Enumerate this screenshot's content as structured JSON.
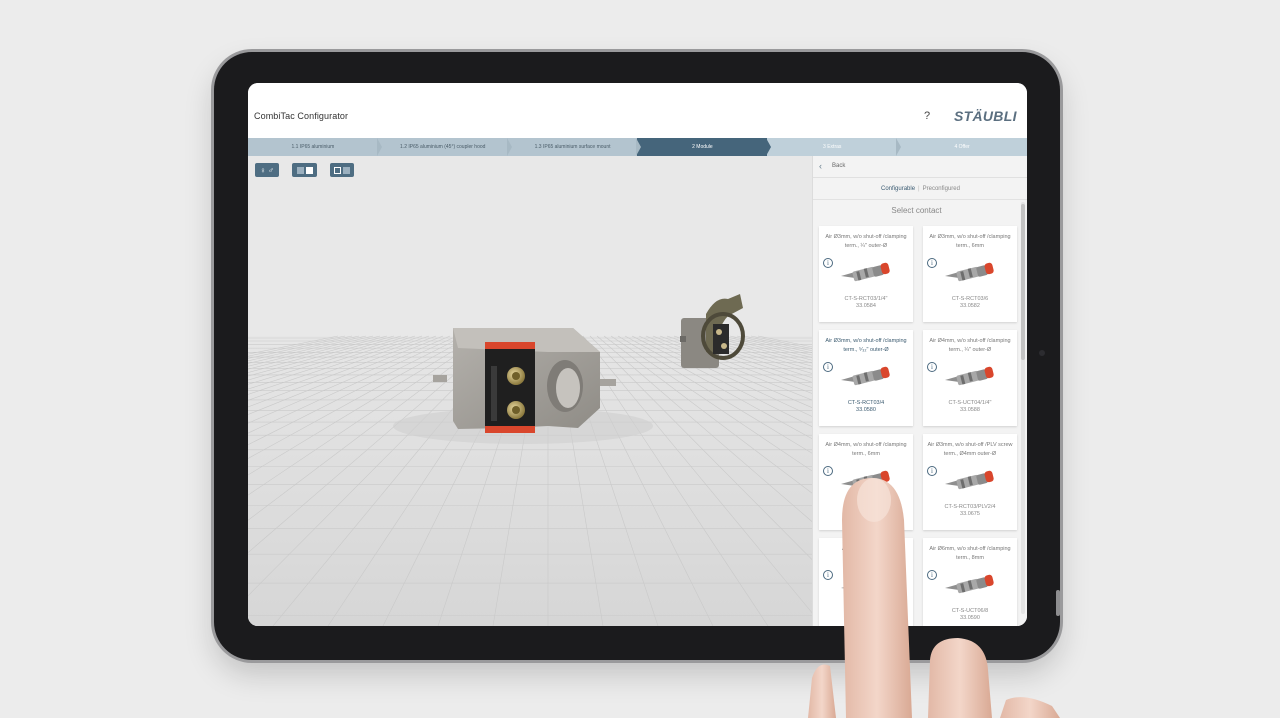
{
  "app": {
    "title": "CombiTac Configurator",
    "help_glyph": "?",
    "brand": "STÄUBLI"
  },
  "steps": [
    {
      "label": "1.1 IP65 aluminium",
      "state": "done"
    },
    {
      "label": "1.2 IP65 aluminium (45°) coupler hood",
      "state": "done"
    },
    {
      "label": "1.3 IP65 aluminium surface mount",
      "state": "done"
    },
    {
      "label": "2 Module",
      "state": "active"
    },
    {
      "label": "3 Extras",
      "state": "future"
    },
    {
      "label": "4 Offer",
      "state": "future"
    }
  ],
  "toolbar": {
    "gender_glyph": "♀ ♂",
    "view_toggle_icon": "two-square-toggle-icon",
    "layout_toggle_icon": "split-square-icon"
  },
  "panel": {
    "back_glyph": "‹",
    "back_label": "Back",
    "modes": [
      "Configurable",
      "Preconfigured"
    ],
    "mode_sep": "|",
    "active_mode": "Configurable",
    "select_title": "Select contact"
  },
  "contacts": [
    {
      "desc": "Air Ø3mm, w/o shut-off /clamping term., ¼\" outer-Ø",
      "code": "CT-S-RCT03/1/4\"",
      "num": "33.0584",
      "selected": false
    },
    {
      "desc": "Air Ø3mm, w/o shut-off /clamping term., 6mm",
      "code": "CT-S-RCT03/6",
      "num": "33.0582",
      "selected": false
    },
    {
      "desc": "Air Ø3mm, w/o shut-off /clamping term., ⁵⁄₃₂\" outer-Ø",
      "code": "CT-S-RCT03/4",
      "num": "33.0580",
      "selected": true
    },
    {
      "desc": "Air Ø4mm, w/o shut-off /clamping term., ¼\" outer-Ø",
      "code": "CT-S-UCT04/1/4\"",
      "num": "33.0588",
      "selected": false
    },
    {
      "desc": "Air Ø4mm, w/o shut-off /clamping term., 6mm",
      "code": "CT-S",
      "num": "",
      "selected": false
    },
    {
      "desc": "Air Ø3mm, w/o shut-off /PLV screw term., Ø4mm outer-Ø",
      "code": "CT-S-RCT03/PLV2/4",
      "num": "33.0675",
      "selected": false
    },
    {
      "desc": "Air Ø3mm, screw te",
      "code": "CT",
      "num": "",
      "selected": false
    },
    {
      "desc": "Air Ø6mm, w/o shut-off /clamping term., 8mm",
      "code": "CT-S-UCT06/8",
      "num": "33.0590",
      "selected": false
    }
  ],
  "colors": {
    "accent": "#45657b",
    "step_bar": "#b9c9d3",
    "contact_tip": "#d9462c",
    "red_module": "#d9462c"
  }
}
